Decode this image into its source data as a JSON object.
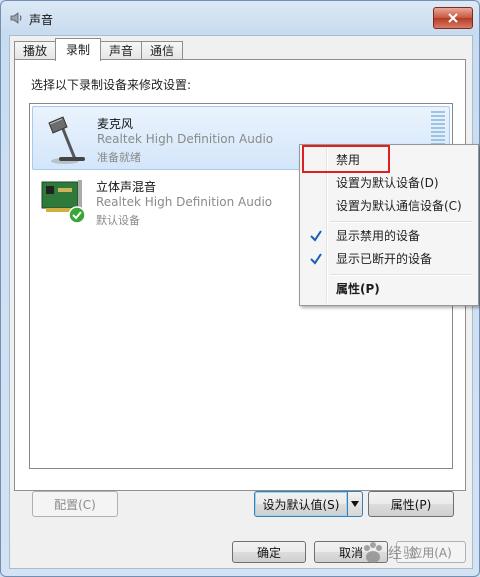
{
  "window": {
    "title": "声音",
    "close_icon": "close-icon"
  },
  "tabs": [
    {
      "label": "播放",
      "active": false
    },
    {
      "label": "录制",
      "active": true
    },
    {
      "label": "声音",
      "active": false
    },
    {
      "label": "通信",
      "active": false
    }
  ],
  "panel": {
    "instruction": "选择以下录制设备来修改设置:",
    "devices": [
      {
        "name": "麦克风",
        "driver": "Realtek High Definition Audio",
        "status": "准备就绪",
        "icon": "microphone-icon",
        "selected": true
      },
      {
        "name": "立体声混音",
        "driver": "Realtek High Definition Audio",
        "status": "默认设备",
        "icon": "sound-card-icon",
        "default_badge_icon": "green-check-icon",
        "selected": false
      }
    ]
  },
  "buttons": {
    "configure": "配置(C)",
    "set_default": "设为默认值(S)",
    "properties": "属性(P)",
    "ok": "确定",
    "cancel": "取消",
    "apply": "应用(A)"
  },
  "context_menu": {
    "items": [
      {
        "label": "禁用",
        "checked": false,
        "bold": false
      },
      {
        "label": "设置为默认设备(D)",
        "checked": false,
        "bold": false
      },
      {
        "label": "设置为默认通信设备(C)",
        "checked": false,
        "bold": false
      },
      {
        "label": "显示禁用的设备",
        "checked": true,
        "bold": false
      },
      {
        "label": "显示已断开的设备",
        "checked": true,
        "bold": false
      },
      {
        "label": "属性(P)",
        "checked": false,
        "bold": true
      }
    ]
  },
  "watermark": {
    "text": "经验"
  },
  "colors": {
    "highlight_box": "#e02020",
    "checkmark": "#1a5fb4",
    "selection": "#d3e6fa"
  }
}
